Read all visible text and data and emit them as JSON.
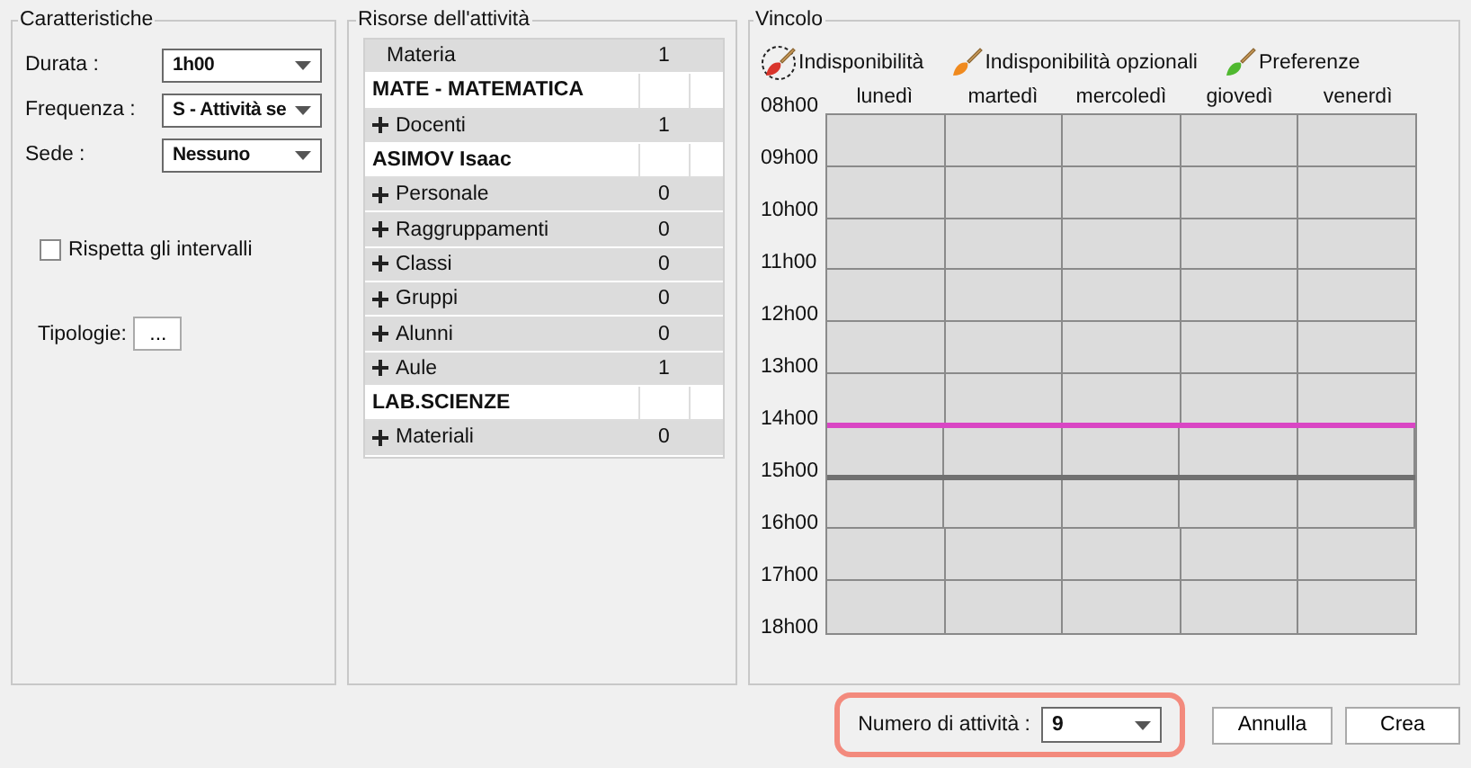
{
  "caratteristiche": {
    "title": "Caratteristiche",
    "fields": [
      {
        "label": "Durata :",
        "value": "1h00"
      },
      {
        "label": "Frequenza :",
        "value": "S - Attività se"
      },
      {
        "label": "Sede :",
        "value": "Nessuno"
      }
    ],
    "checkbox": {
      "label": "Rispetta gli intervalli",
      "checked": false
    },
    "tipologie": {
      "label": "Tipologie:",
      "button": "..."
    }
  },
  "risorse": {
    "title": "Risorse dell'attività",
    "rows": [
      {
        "kind": "category",
        "label": "Materia",
        "count": "1",
        "expandable": false
      },
      {
        "kind": "item",
        "label": "MATE - MATEMATICA"
      },
      {
        "kind": "category",
        "label": "Docenti",
        "count": "1",
        "expandable": true
      },
      {
        "kind": "item",
        "label": "ASIMOV Isaac"
      },
      {
        "kind": "category",
        "label": "Personale",
        "count": "0",
        "expandable": true
      },
      {
        "kind": "category",
        "label": "Raggruppamenti",
        "count": "0",
        "expandable": true
      },
      {
        "kind": "category",
        "label": "Classi",
        "count": "0",
        "expandable": true
      },
      {
        "kind": "category",
        "label": "Gruppi",
        "count": "0",
        "expandable": true
      },
      {
        "kind": "category",
        "label": "Alunni",
        "count": "0",
        "expandable": true
      },
      {
        "kind": "category",
        "label": "Aule",
        "count": "1",
        "expandable": true
      },
      {
        "kind": "item",
        "label": "LAB.SCIENZE"
      },
      {
        "kind": "category",
        "label": "Materiali",
        "count": "0",
        "expandable": true
      }
    ]
  },
  "vincolo": {
    "title": "Vincolo",
    "tools": [
      {
        "label": "Indisponibilità",
        "color": "#d9342b",
        "selected": true
      },
      {
        "label": "Indisponibilità opzionali",
        "color": "#f08a1e",
        "selected": false
      },
      {
        "label": "Preferenze",
        "color": "#4fb82f",
        "selected": false
      }
    ],
    "days": [
      "lunedì",
      "martedì",
      "mercoledì",
      "giovedì",
      "venerdì"
    ],
    "hours": [
      {
        "label": "08h00"
      },
      {
        "label": "09h00"
      },
      {
        "label": "10h00"
      },
      {
        "label": "11h00"
      },
      {
        "label": "12h00"
      },
      {
        "label": "13h00"
      },
      {
        "label": "14h00",
        "color": "#d946c4"
      },
      {
        "label": "15h00",
        "color": "#707070"
      },
      {
        "label": "16h00"
      },
      {
        "label": "17h00"
      },
      {
        "label": "18h00"
      }
    ]
  },
  "footer": {
    "count_label": "Numero di attività :",
    "count_value": "9",
    "highlighted": true,
    "buttons": [
      "Annulla",
      "Crea"
    ]
  }
}
